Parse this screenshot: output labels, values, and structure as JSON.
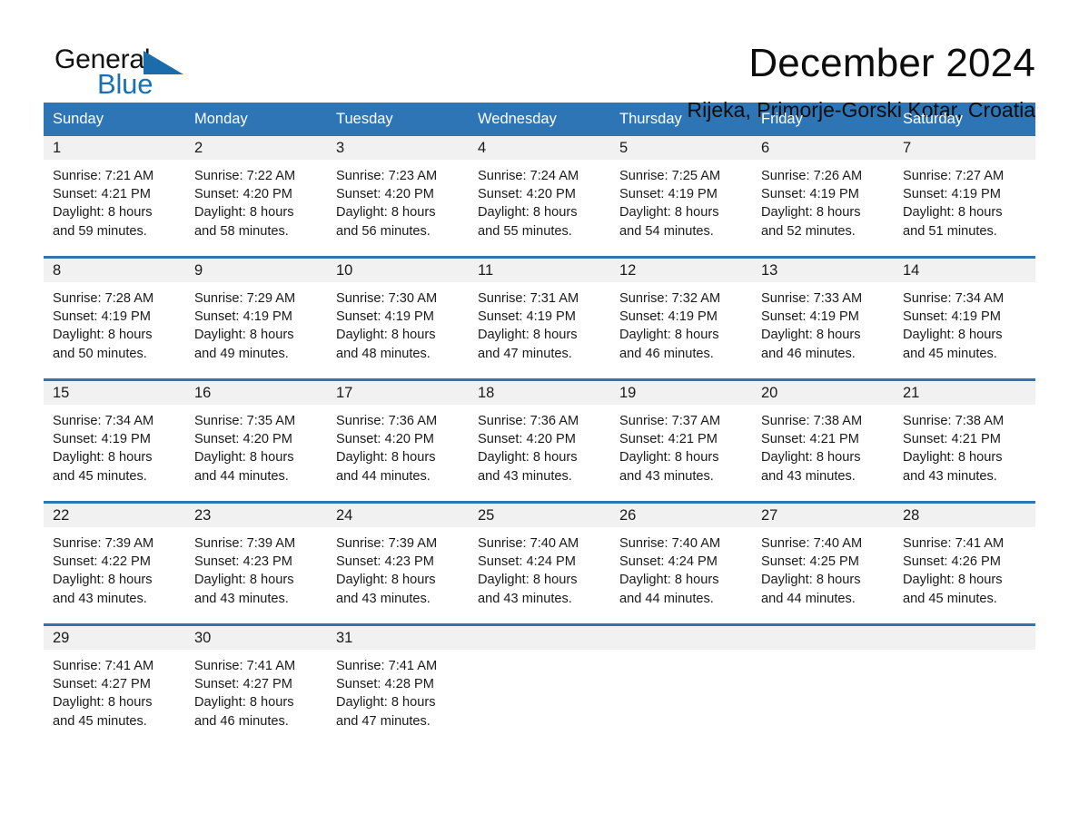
{
  "brand": {
    "name_part1": "General",
    "name_part2": "Blue",
    "accent_color": "#1b6cab"
  },
  "header": {
    "title": "December 2024",
    "subtitle": "Rijeka, Primorje-Gorski Kotar, Croatia"
  },
  "calendar": {
    "header_bg": "#2e75b6",
    "daynum_bg": "#f1f1f1",
    "weekdays": [
      "Sunday",
      "Monday",
      "Tuesday",
      "Wednesday",
      "Thursday",
      "Friday",
      "Saturday"
    ],
    "weeks": [
      {
        "days": [
          {
            "day": "1",
            "sunrise": "Sunrise: 7:21 AM",
            "sunset": "Sunset: 4:21 PM",
            "daylight_line1": "Daylight: 8 hours",
            "daylight_line2": "and 59 minutes."
          },
          {
            "day": "2",
            "sunrise": "Sunrise: 7:22 AM",
            "sunset": "Sunset: 4:20 PM",
            "daylight_line1": "Daylight: 8 hours",
            "daylight_line2": "and 58 minutes."
          },
          {
            "day": "3",
            "sunrise": "Sunrise: 7:23 AM",
            "sunset": "Sunset: 4:20 PM",
            "daylight_line1": "Daylight: 8 hours",
            "daylight_line2": "and 56 minutes."
          },
          {
            "day": "4",
            "sunrise": "Sunrise: 7:24 AM",
            "sunset": "Sunset: 4:20 PM",
            "daylight_line1": "Daylight: 8 hours",
            "daylight_line2": "and 55 minutes."
          },
          {
            "day": "5",
            "sunrise": "Sunrise: 7:25 AM",
            "sunset": "Sunset: 4:19 PM",
            "daylight_line1": "Daylight: 8 hours",
            "daylight_line2": "and 54 minutes."
          },
          {
            "day": "6",
            "sunrise": "Sunrise: 7:26 AM",
            "sunset": "Sunset: 4:19 PM",
            "daylight_line1": "Daylight: 8 hours",
            "daylight_line2": "and 52 minutes."
          },
          {
            "day": "7",
            "sunrise": "Sunrise: 7:27 AM",
            "sunset": "Sunset: 4:19 PM",
            "daylight_line1": "Daylight: 8 hours",
            "daylight_line2": "and 51 minutes."
          }
        ]
      },
      {
        "days": [
          {
            "day": "8",
            "sunrise": "Sunrise: 7:28 AM",
            "sunset": "Sunset: 4:19 PM",
            "daylight_line1": "Daylight: 8 hours",
            "daylight_line2": "and 50 minutes."
          },
          {
            "day": "9",
            "sunrise": "Sunrise: 7:29 AM",
            "sunset": "Sunset: 4:19 PM",
            "daylight_line1": "Daylight: 8 hours",
            "daylight_line2": "and 49 minutes."
          },
          {
            "day": "10",
            "sunrise": "Sunrise: 7:30 AM",
            "sunset": "Sunset: 4:19 PM",
            "daylight_line1": "Daylight: 8 hours",
            "daylight_line2": "and 48 minutes."
          },
          {
            "day": "11",
            "sunrise": "Sunrise: 7:31 AM",
            "sunset": "Sunset: 4:19 PM",
            "daylight_line1": "Daylight: 8 hours",
            "daylight_line2": "and 47 minutes."
          },
          {
            "day": "12",
            "sunrise": "Sunrise: 7:32 AM",
            "sunset": "Sunset: 4:19 PM",
            "daylight_line1": "Daylight: 8 hours",
            "daylight_line2": "and 46 minutes."
          },
          {
            "day": "13",
            "sunrise": "Sunrise: 7:33 AM",
            "sunset": "Sunset: 4:19 PM",
            "daylight_line1": "Daylight: 8 hours",
            "daylight_line2": "and 46 minutes."
          },
          {
            "day": "14",
            "sunrise": "Sunrise: 7:34 AM",
            "sunset": "Sunset: 4:19 PM",
            "daylight_line1": "Daylight: 8 hours",
            "daylight_line2": "and 45 minutes."
          }
        ]
      },
      {
        "days": [
          {
            "day": "15",
            "sunrise": "Sunrise: 7:34 AM",
            "sunset": "Sunset: 4:19 PM",
            "daylight_line1": "Daylight: 8 hours",
            "daylight_line2": "and 45 minutes."
          },
          {
            "day": "16",
            "sunrise": "Sunrise: 7:35 AM",
            "sunset": "Sunset: 4:20 PM",
            "daylight_line1": "Daylight: 8 hours",
            "daylight_line2": "and 44 minutes."
          },
          {
            "day": "17",
            "sunrise": "Sunrise: 7:36 AM",
            "sunset": "Sunset: 4:20 PM",
            "daylight_line1": "Daylight: 8 hours",
            "daylight_line2": "and 44 minutes."
          },
          {
            "day": "18",
            "sunrise": "Sunrise: 7:36 AM",
            "sunset": "Sunset: 4:20 PM",
            "daylight_line1": "Daylight: 8 hours",
            "daylight_line2": "and 43 minutes."
          },
          {
            "day": "19",
            "sunrise": "Sunrise: 7:37 AM",
            "sunset": "Sunset: 4:21 PM",
            "daylight_line1": "Daylight: 8 hours",
            "daylight_line2": "and 43 minutes."
          },
          {
            "day": "20",
            "sunrise": "Sunrise: 7:38 AM",
            "sunset": "Sunset: 4:21 PM",
            "daylight_line1": "Daylight: 8 hours",
            "daylight_line2": "and 43 minutes."
          },
          {
            "day": "21",
            "sunrise": "Sunrise: 7:38 AM",
            "sunset": "Sunset: 4:21 PM",
            "daylight_line1": "Daylight: 8 hours",
            "daylight_line2": "and 43 minutes."
          }
        ]
      },
      {
        "days": [
          {
            "day": "22",
            "sunrise": "Sunrise: 7:39 AM",
            "sunset": "Sunset: 4:22 PM",
            "daylight_line1": "Daylight: 8 hours",
            "daylight_line2": "and 43 minutes."
          },
          {
            "day": "23",
            "sunrise": "Sunrise: 7:39 AM",
            "sunset": "Sunset: 4:23 PM",
            "daylight_line1": "Daylight: 8 hours",
            "daylight_line2": "and 43 minutes."
          },
          {
            "day": "24",
            "sunrise": "Sunrise: 7:39 AM",
            "sunset": "Sunset: 4:23 PM",
            "daylight_line1": "Daylight: 8 hours",
            "daylight_line2": "and 43 minutes."
          },
          {
            "day": "25",
            "sunrise": "Sunrise: 7:40 AM",
            "sunset": "Sunset: 4:24 PM",
            "daylight_line1": "Daylight: 8 hours",
            "daylight_line2": "and 43 minutes."
          },
          {
            "day": "26",
            "sunrise": "Sunrise: 7:40 AM",
            "sunset": "Sunset: 4:24 PM",
            "daylight_line1": "Daylight: 8 hours",
            "daylight_line2": "and 44 minutes."
          },
          {
            "day": "27",
            "sunrise": "Sunrise: 7:40 AM",
            "sunset": "Sunset: 4:25 PM",
            "daylight_line1": "Daylight: 8 hours",
            "daylight_line2": "and 44 minutes."
          },
          {
            "day": "28",
            "sunrise": "Sunrise: 7:41 AM",
            "sunset": "Sunset: 4:26 PM",
            "daylight_line1": "Daylight: 8 hours",
            "daylight_line2": "and 45 minutes."
          }
        ]
      },
      {
        "days": [
          {
            "day": "29",
            "sunrise": "Sunrise: 7:41 AM",
            "sunset": "Sunset: 4:27 PM",
            "daylight_line1": "Daylight: 8 hours",
            "daylight_line2": "and 45 minutes."
          },
          {
            "day": "30",
            "sunrise": "Sunrise: 7:41 AM",
            "sunset": "Sunset: 4:27 PM",
            "daylight_line1": "Daylight: 8 hours",
            "daylight_line2": "and 46 minutes."
          },
          {
            "day": "31",
            "sunrise": "Sunrise: 7:41 AM",
            "sunset": "Sunset: 4:28 PM",
            "daylight_line1": "Daylight: 8 hours",
            "daylight_line2": "and 47 minutes."
          },
          {
            "day": "",
            "sunrise": "",
            "sunset": "",
            "daylight_line1": "",
            "daylight_line2": ""
          },
          {
            "day": "",
            "sunrise": "",
            "sunset": "",
            "daylight_line1": "",
            "daylight_line2": ""
          },
          {
            "day": "",
            "sunrise": "",
            "sunset": "",
            "daylight_line1": "",
            "daylight_line2": ""
          },
          {
            "day": "",
            "sunrise": "",
            "sunset": "",
            "daylight_line1": "",
            "daylight_line2": ""
          }
        ]
      }
    ]
  }
}
